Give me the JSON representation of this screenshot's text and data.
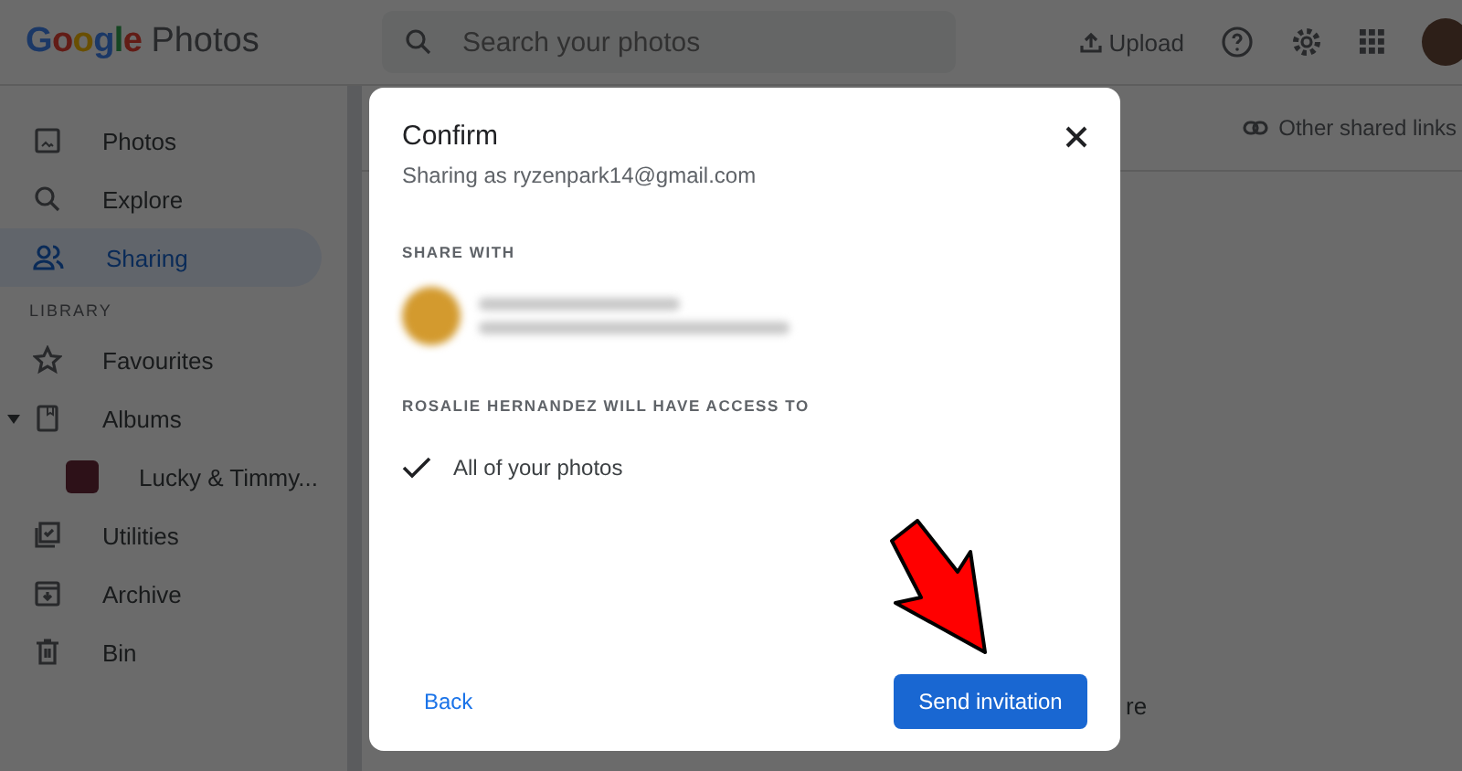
{
  "header": {
    "logo": {
      "brand": "Google",
      "product": "Photos"
    },
    "search": {
      "placeholder": "Search your photos"
    },
    "upload": "Upload"
  },
  "sidebar": {
    "items": [
      {
        "label": "Photos",
        "selected": false
      },
      {
        "label": "Explore",
        "selected": false
      },
      {
        "label": "Sharing",
        "selected": true
      }
    ],
    "section": "LIBRARY",
    "library": [
      {
        "label": "Favourites",
        "kind": "item"
      },
      {
        "label": "Albums",
        "kind": "group",
        "expanded": true,
        "children": [
          {
            "label": "Lucky & Timmy...",
            "kind": "album"
          }
        ]
      },
      {
        "label": "Utilities",
        "kind": "item"
      },
      {
        "label": "Archive",
        "kind": "item"
      },
      {
        "label": "Bin",
        "kind": "item"
      }
    ]
  },
  "main": {
    "links": "Other shared links",
    "fragment": "re"
  },
  "dialog": {
    "title": "Confirm",
    "subtitle": "Sharing as ryzenpark14@gmail.com",
    "share_heading": "SHARE WITH",
    "access_heading": "ROSALIE HERNANDEZ WILL HAVE ACCESS TO",
    "access": [
      {
        "label": "All of your photos",
        "checked": true
      }
    ],
    "back": "Back",
    "send": "Send invitation"
  }
}
